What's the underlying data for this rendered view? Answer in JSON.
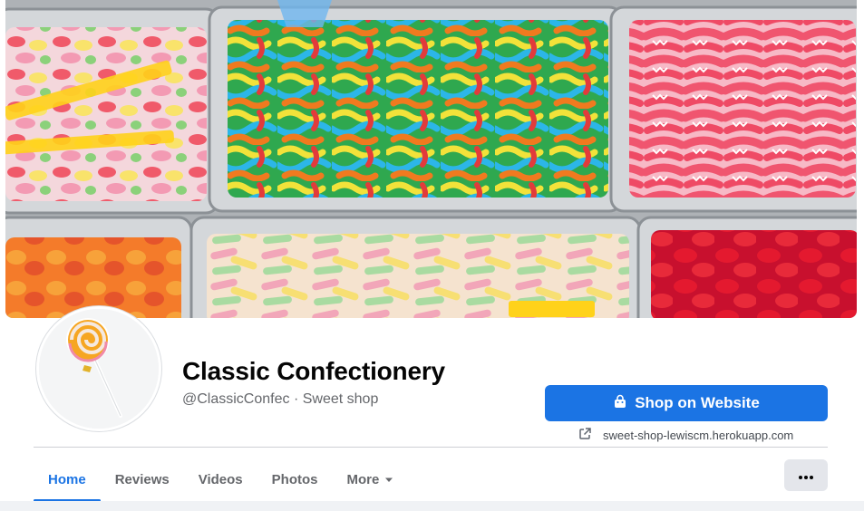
{
  "page": {
    "name": "Classic Confectionery",
    "handle": "@ClassicConfec",
    "separator": "·",
    "category": "Sweet shop"
  },
  "cta": {
    "label": "Shop on Website",
    "icon": "shopping-bag-icon",
    "link_text": "sweet-shop-lewiscm.herokuapp.com",
    "link_icon": "external-link-icon"
  },
  "tabs": [
    {
      "label": "Home",
      "active": true
    },
    {
      "label": "Reviews",
      "active": false
    },
    {
      "label": "Videos",
      "active": false
    },
    {
      "label": "Photos",
      "active": false
    },
    {
      "label": "More",
      "active": false
    }
  ],
  "more_menu_icon": "more-dots-icon",
  "colors": {
    "accent": "#1b74e4",
    "text_primary": "#050505",
    "text_secondary": "#65676b",
    "button_grey": "#e4e6eb"
  }
}
